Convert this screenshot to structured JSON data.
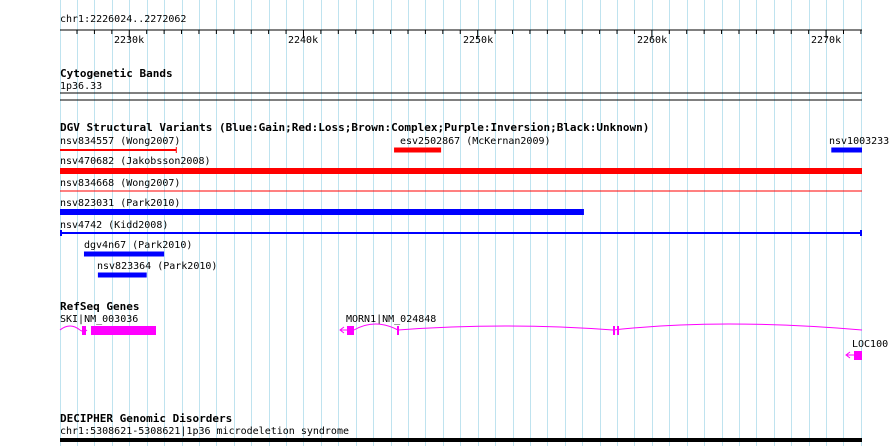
{
  "ruler": {
    "location": "chr1:2226024..2272062",
    "ticks": [
      {
        "label": "2230k",
        "pos": 2230000
      },
      {
        "label": "2240k",
        "pos": 2240000
      },
      {
        "label": "2250k",
        "pos": 2250000
      },
      {
        "label": "2260k",
        "pos": 2260000
      },
      {
        "label": "2270k",
        "pos": 2270000
      }
    ]
  },
  "tracks": {
    "cytogenetic": {
      "title": "Cytogenetic Bands",
      "band": "1p36.33"
    },
    "dgv": {
      "title": "DGV Structural Variants (Blue:Gain;Red:Loss;Brown:Complex;Purple:Inversion;Black:Unknown)",
      "features": [
        {
          "id": "f1",
          "label": "nsv834557 (Wong2007)",
          "type": "loss-thin",
          "start": 2226024,
          "end": 2232700,
          "color": "#ff0000"
        },
        {
          "id": "f2",
          "label": "esv2502867 (McKernan2009)",
          "type": "loss",
          "start": 2245200,
          "end": 2247900,
          "color": "#ff0000"
        },
        {
          "id": "f3",
          "label": "nsv1003233",
          "type": "gain",
          "start": 2270300,
          "end": 2272062,
          "color": "#0000ff"
        },
        {
          "id": "f4",
          "label": "nsv470682 (Jakobsson2008)",
          "type": "loss",
          "start": 2226024,
          "end": 2272062,
          "color": "#ff0000"
        },
        {
          "id": "f5",
          "label": "nsv834668 (Wong2007)",
          "type": "loss-thin",
          "start": 2226024,
          "end": 2272062,
          "color": "#ff0000"
        },
        {
          "id": "f6",
          "label": "nsv823031 (Park2010)",
          "type": "gain",
          "start": 2226024,
          "end": 2256100,
          "color": "#0000ff"
        },
        {
          "id": "f7",
          "label": "nsv4742 (Kidd2008)",
          "type": "gain-thin",
          "start": 2226024,
          "end": 2272062,
          "color": "#0000ff"
        },
        {
          "id": "f8",
          "label": "dgv4n67 (Park2010)",
          "type": "gain",
          "start": 2227400,
          "end": 2232000,
          "color": "#0000ff"
        },
        {
          "id": "f9",
          "label": "nsv823364 (Park2010)",
          "type": "gain",
          "start": 2228200,
          "end": 2231000,
          "color": "#0000ff"
        }
      ]
    },
    "refseq": {
      "title": "RefSeq Genes",
      "genes": [
        {
          "label": "SKI|NM_003036",
          "color": "#ff00ff"
        },
        {
          "label": "MORN1|NM_024848",
          "color": "#ff00ff"
        },
        {
          "label": "LOC100",
          "color": "#ff00ff"
        }
      ]
    },
    "decipher": {
      "title": "DECIPHER Genomic Disorders",
      "feature": "chr1:5308621-5308621|1p36 microdeletion syndrome"
    }
  }
}
